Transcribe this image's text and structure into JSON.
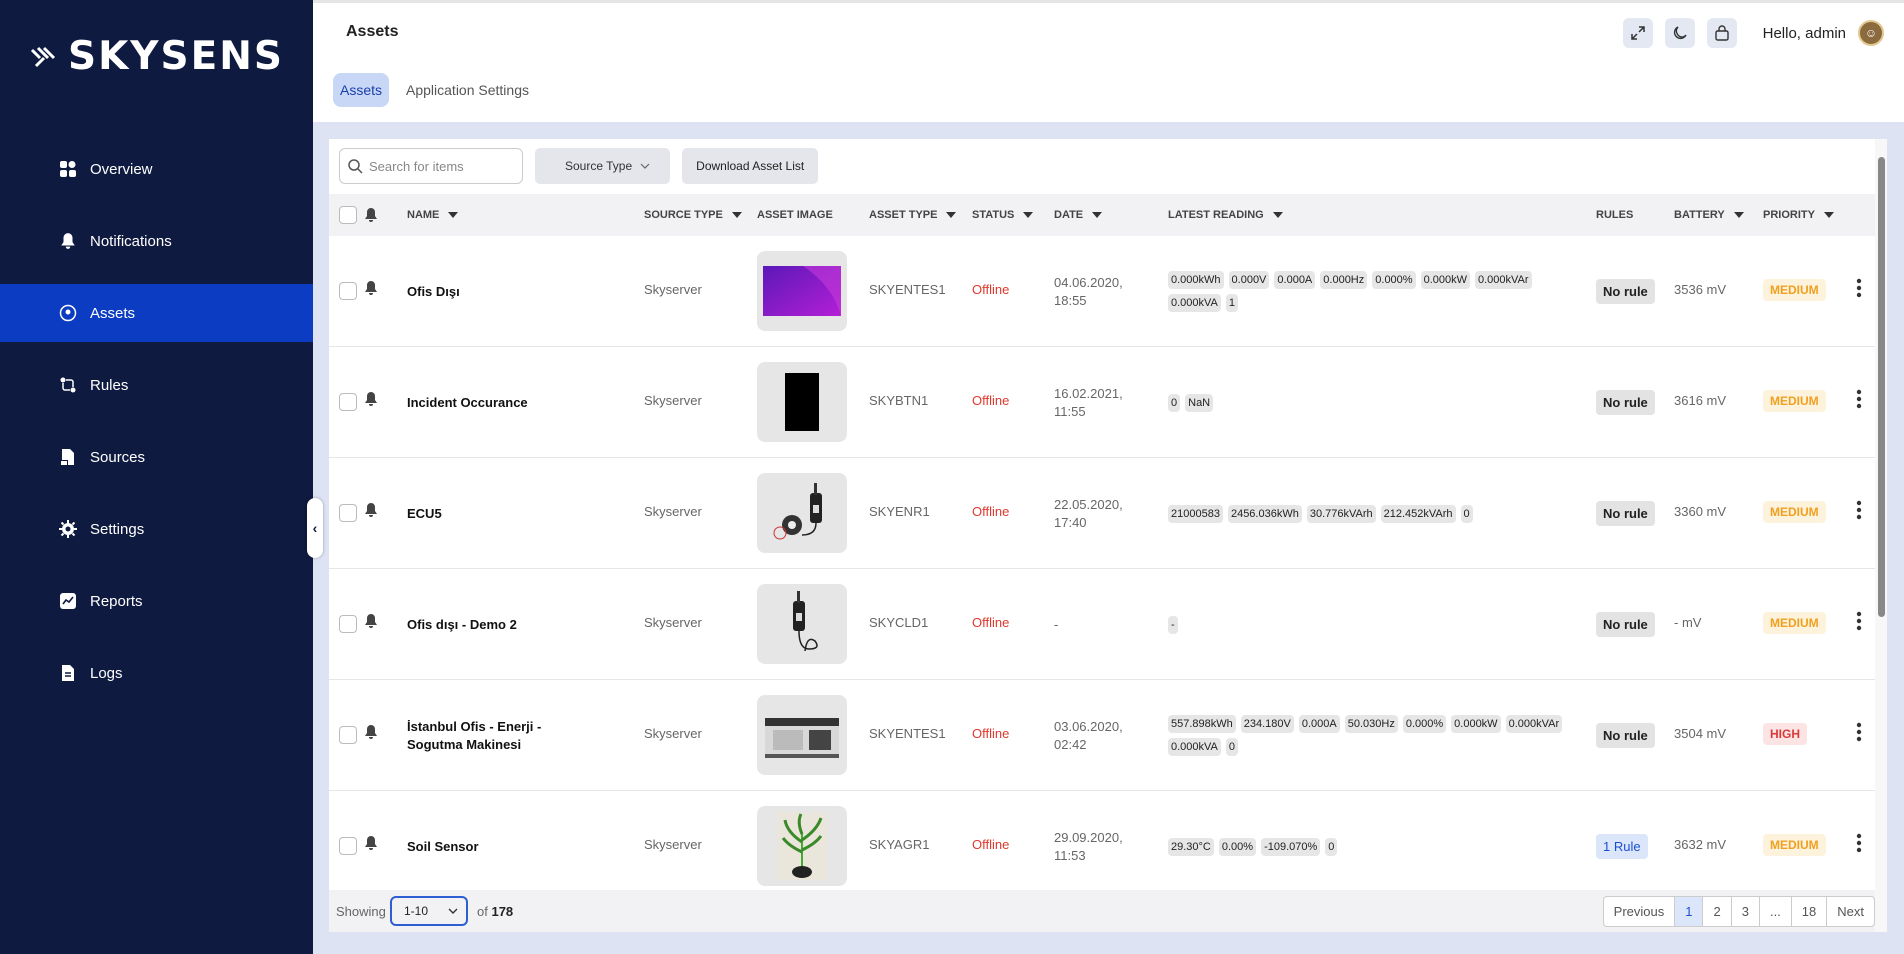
{
  "brand": {
    "name": "SKYSENS"
  },
  "sidebar": {
    "items": [
      {
        "label": "Overview",
        "icon": "grid-icon"
      },
      {
        "label": "Notifications",
        "icon": "bell-icon"
      },
      {
        "label": "Assets",
        "icon": "location-icon",
        "active": true
      },
      {
        "label": "Rules",
        "icon": "rules-icon"
      },
      {
        "label": "Sources",
        "icon": "file-icon"
      },
      {
        "label": "Settings",
        "icon": "gear-icon"
      },
      {
        "label": "Reports",
        "icon": "chart-icon"
      },
      {
        "label": "Logs",
        "icon": "log-icon"
      }
    ]
  },
  "header": {
    "title": "Assets",
    "tabs": [
      {
        "label": "Assets"
      },
      {
        "label": "Application Settings"
      }
    ],
    "greeting": "Hello, admin"
  },
  "toolbar": {
    "search_placeholder": "Search for items",
    "source_type_label": "Source Type",
    "download_label": "Download Asset List"
  },
  "table": {
    "columns": {
      "name": "NAME",
      "source_type": "SOURCE TYPE",
      "asset_image": "ASSET IMAGE",
      "asset_type": "ASSET TYPE",
      "status": "STATUS",
      "date": "DATE",
      "latest_reading": "LATEST READING",
      "rules": "RULES",
      "battery": "BATTERY",
      "priority": "PRIORITY"
    },
    "rows": [
      {
        "name": "Ofis Dışı",
        "source_type": "Skyserver",
        "asset_type": "SKYENTES1",
        "status": "Offline",
        "date": "04.06.2020,\n18:55",
        "readings": [
          "0.000kWh",
          "0.000V",
          "0.000A",
          "0.000Hz",
          "0.000%",
          "0.000kW",
          "0.000kVAr",
          "0.000kVA",
          "1"
        ],
        "rule": "No rule",
        "battery": "3536 mV",
        "priority": "MEDIUM",
        "image": "purple-screen"
      },
      {
        "name": "Incident Occurance",
        "source_type": "Skyserver",
        "asset_type": "SKYBTN1",
        "status": "Offline",
        "date": "16.02.2021,\n11:55",
        "readings": [
          "0",
          "NaN"
        ],
        "rule": "No rule",
        "battery": "3616 mV",
        "priority": "MEDIUM",
        "image": "black-panel"
      },
      {
        "name": "ECU5",
        "source_type": "Skyserver",
        "asset_type": "SKYENR1",
        "status": "Offline",
        "date": "22.05.2020,\n17:40",
        "readings": [
          "21000583",
          "2456.036kWh",
          "30.776kVArh",
          "212.452kVArh",
          "0"
        ],
        "rule": "No rule",
        "battery": "3360 mV",
        "priority": "MEDIUM",
        "image": "sensor-clamp"
      },
      {
        "name": "Ofis dışı - Demo 2",
        "source_type": "Skyserver",
        "asset_type": "SKYCLD1",
        "status": "Offline",
        "date": "-",
        "readings": [
          "-"
        ],
        "rule": "No rule",
        "battery": "- mV",
        "priority": "MEDIUM",
        "image": "sensor-probe"
      },
      {
        "name": "İstanbul Ofis - Enerji - Sogutma Makinesi",
        "source_type": "Skyserver",
        "asset_type": "SKYENTES1",
        "status": "Offline",
        "date": "03.06.2020,\n02:42",
        "readings": [
          "557.898kWh",
          "234.180V",
          "0.000A",
          "50.030Hz",
          "0.000%",
          "0.000kW",
          "0.000kVAr",
          "0.000kVA",
          "0"
        ],
        "rule": "No rule",
        "battery": "3504 mV",
        "priority": "HIGH",
        "image": "machine"
      },
      {
        "name": "Soil Sensor",
        "source_type": "Skyserver",
        "asset_type": "SKYAGR1",
        "status": "Offline",
        "date": "29.09.2020,\n11:53",
        "readings": [
          "29.30°C",
          "0.00%",
          "-109.070%",
          "0"
        ],
        "rule": "1 Rule",
        "battery": "3632 mV",
        "priority": "MEDIUM",
        "image": "plant"
      }
    ]
  },
  "footer": {
    "showing_label": "Showing",
    "page_size": "1-10",
    "of_label": "of",
    "total": "178",
    "pages": [
      "Previous",
      "1",
      "2",
      "3",
      "...",
      "18",
      "Next"
    ],
    "current_page": "1"
  },
  "colors": {
    "sidebar": "#0e1a3f",
    "active": "#0b3cc1",
    "offline": "#e0382d"
  }
}
